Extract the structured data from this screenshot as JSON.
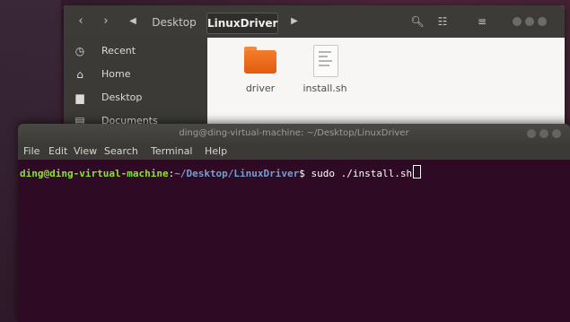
{
  "files_window": {
    "nav": {
      "back_icon": "chevron-left-icon",
      "forward_icon": "chevron-right-icon"
    },
    "breadcrumbs": [
      "Desktop",
      "LinuxDriver"
    ],
    "sidebar": {
      "items": [
        {
          "label": "Recent",
          "icon": "clock-icon"
        },
        {
          "label": "Home",
          "icon": "home-icon"
        },
        {
          "label": "Desktop",
          "icon": "folder-icon"
        },
        {
          "label": "Documents",
          "icon": "document-icon"
        }
      ]
    },
    "files": [
      {
        "name": "driver",
        "type": "folder"
      },
      {
        "name": "install.sh",
        "type": "script"
      }
    ]
  },
  "terminal": {
    "title": "ding@ding-virtual-machine: ~/Desktop/LinuxDriver",
    "menu": [
      "File",
      "Edit",
      "View",
      "Search",
      "Terminal",
      "Help"
    ],
    "prompt": {
      "user_host": "ding@ding-virtual-machine",
      "separator": ":",
      "path": "~/Desktop/LinuxDriver",
      "symbol": "$",
      "command": " sudo ./install.sh"
    }
  },
  "colors": {
    "terminal_bg": "#300a24",
    "prompt_user": "#8ae234",
    "prompt_path": "#729fcf",
    "folder": "#e15b10"
  }
}
